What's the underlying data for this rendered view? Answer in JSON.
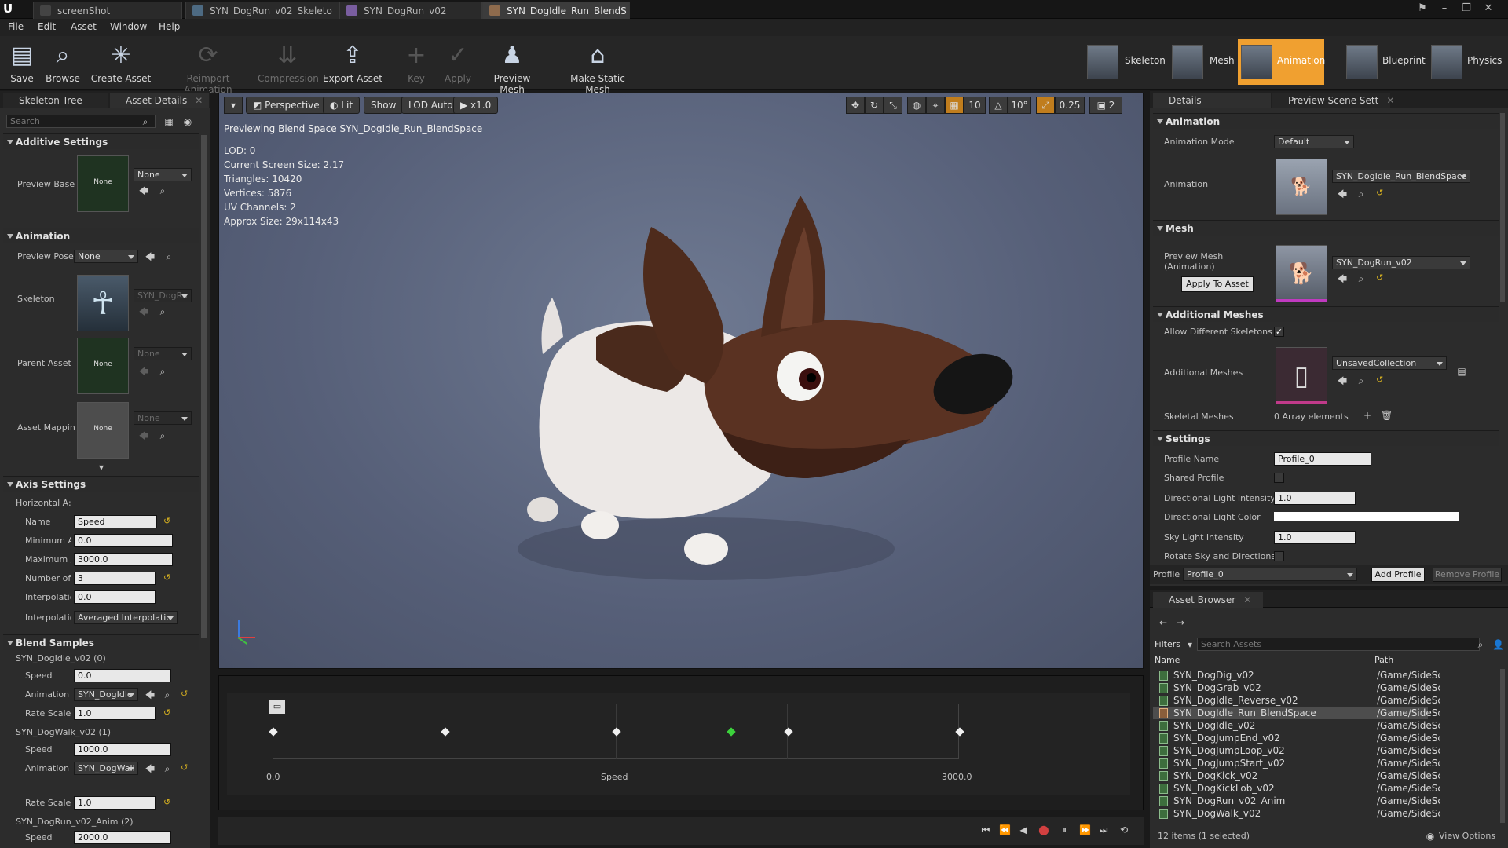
{
  "window": {
    "tabs": [
      "screenShot",
      "SYN_DogRun_v02_Skeleto",
      "SYN_DogRun_v02",
      "SYN_DogIdle_Run_BlendS"
    ]
  },
  "menu": [
    "File",
    "Edit",
    "Asset",
    "Window",
    "Help"
  ],
  "toolbar": {
    "buttons": [
      "Save",
      "Browse",
      "Create Asset",
      "Reimport Animation",
      "Compression",
      "Export Asset",
      "Key",
      "Apply",
      "Preview Mesh",
      "Make Static Mesh"
    ]
  },
  "modes": [
    "Skeleton",
    "Mesh",
    "Animation",
    "Blueprint",
    "Physics"
  ],
  "left": {
    "tabs": [
      "Skeleton Tree",
      "Asset Details"
    ],
    "search_placeholder": "Search",
    "additive": {
      "title": "Additive Settings",
      "preview_base_label": "Preview Base",
      "preview_base_value": "None",
      "thumb": "None"
    },
    "animation": {
      "title": "Animation",
      "preview_pose_label": "Preview Pose",
      "preview_pose_value": "None",
      "skeleton_label": "Skeleton",
      "skeleton_value": "SYN_DogRu",
      "parent_label": "Parent Asset",
      "parent_value": "None",
      "parent_thumb": "None",
      "mapping_label": "Asset Mappin",
      "mapping_value": "None",
      "mapping_thumb": "None"
    },
    "axis": {
      "title": "Axis Settings",
      "sub": "Horizontal A:",
      "name_label": "Name",
      "name_value": "Speed",
      "min_label": "Minimum A",
      "min_value": "0.0",
      "max_label": "Maximum /",
      "max_value": "3000.0",
      "num_label": "Number of (",
      "num_value": "3",
      "interp_label": "Interpolatio",
      "interp_value": "0.0",
      "interp2_label": "Interpolatio",
      "interp2_value": "Averaged Interpolatio"
    },
    "blend": {
      "title": "Blend Samples",
      "samples": [
        {
          "name": "SYN_DogIdle_v02 (0)",
          "speed": "0.0",
          "anim": "SYN_DogIdle",
          "rate": "1.0"
        },
        {
          "name": "SYN_DogWalk_v02 (1)",
          "speed": "1000.0",
          "anim": "SYN_DogWall",
          "rate": "1.0"
        },
        {
          "name": "SYN_DogRun_v02_Anim (2)",
          "speed": "2000.0"
        }
      ],
      "speed_label": "Speed",
      "anim_label": "Animation",
      "rate_label": "Rate Scale"
    }
  },
  "viewport": {
    "perspective": "Perspective",
    "lit": "Lit",
    "show": "Show",
    "lod": "LOD Auto",
    "speed": "x1.0",
    "snap1": "10",
    "snap2": "10°",
    "snap3": "0.25",
    "cam": "2",
    "preview_text": "Previewing Blend Space SYN_DogIdle_Run_BlendSpace",
    "stats": [
      "LOD: 0",
      "Current Screen Size: 2.17",
      "Triangles: 10420",
      "Vertices: 5876",
      "UV Channels: 2",
      "Approx Size: 29x114x43"
    ]
  },
  "timeline": {
    "min": "0.0",
    "label": "Speed",
    "max": "3000.0",
    "samples": [
      0,
      0.25,
      0.5,
      0.667,
      0.75,
      1
    ]
  },
  "details": {
    "tabs": [
      "Details",
      "Preview Scene Sett"
    ],
    "animation": {
      "title": "Animation",
      "mode_label": "Animation Mode",
      "mode_value": "Default",
      "anim_label": "Animation",
      "anim_value": "SYN_DogIdle_Run_BlendSpace"
    },
    "mesh": {
      "title": "Mesh",
      "preview_label": "Preview Mesh (Animation)",
      "preview_value": "SYN_DogRun_v02",
      "apply": "Apply To Asset"
    },
    "additional": {
      "title": "Additional Meshes",
      "allow_label": "Allow Different Skeletons",
      "meshes_label": "Additional Meshes",
      "meshes_value": "UnsavedCollection",
      "skeletal_label": "Skeletal Meshes",
      "skeletal_value": "0 Array elements"
    },
    "settings": {
      "title": "Settings",
      "profile_name_label": "Profile Name",
      "profile_name_value": "Profile_0",
      "shared_label": "Shared Profile",
      "dir_int_label": "Directional Light Intensity",
      "dir_int_value": "1.0",
      "dir_color_label": "Directional Light Color",
      "sky_label": "Sky Light Intensity",
      "sky_value": "1.0",
      "rotate_label": "Rotate Sky and Directional"
    },
    "profile": {
      "label": "Profile",
      "value": "Profile_0",
      "add": "Add Profile",
      "remove": "Remove Profile"
    }
  },
  "browser": {
    "tab": "Asset Browser",
    "filters": "Filters",
    "search_placeholder": "Search Assets",
    "col_name": "Name",
    "col_path": "Path",
    "assets": [
      {
        "name": "SYN_DogDig_v02",
        "path": "/Game/SideScroller/Chara"
      },
      {
        "name": "SYN_DogGrab_v02",
        "path": "/Game/SideScroller/Chara"
      },
      {
        "name": "SYN_DogIdle_Reverse_v02",
        "path": "/Game/SideScroller/Chara"
      },
      {
        "name": "SYN_DogIdle_Run_BlendSpace",
        "path": "/Game/SideScroller/Chara"
      },
      {
        "name": "SYN_DogIdle_v02",
        "path": "/Game/SideScroller/Chara"
      },
      {
        "name": "SYN_DogJumpEnd_v02",
        "path": "/Game/SideScroller/Chara"
      },
      {
        "name": "SYN_DogJumpLoop_v02",
        "path": "/Game/SideScroller/Chara"
      },
      {
        "name": "SYN_DogJumpStart_v02",
        "path": "/Game/SideScroller/Chara"
      },
      {
        "name": "SYN_DogKick_v02",
        "path": "/Game/SideScroller/Chara"
      },
      {
        "name": "SYN_DogKickLob_v02",
        "path": "/Game/SideScroller/Chara"
      },
      {
        "name": "SYN_DogRun_v02_Anim",
        "path": "/Game/SideScroller/Chara"
      },
      {
        "name": "SYN_DogWalk_v02",
        "path": "/Game/SideScroller/Chara"
      }
    ],
    "status": "12 items (1 selected)",
    "view_options": "View Options"
  }
}
